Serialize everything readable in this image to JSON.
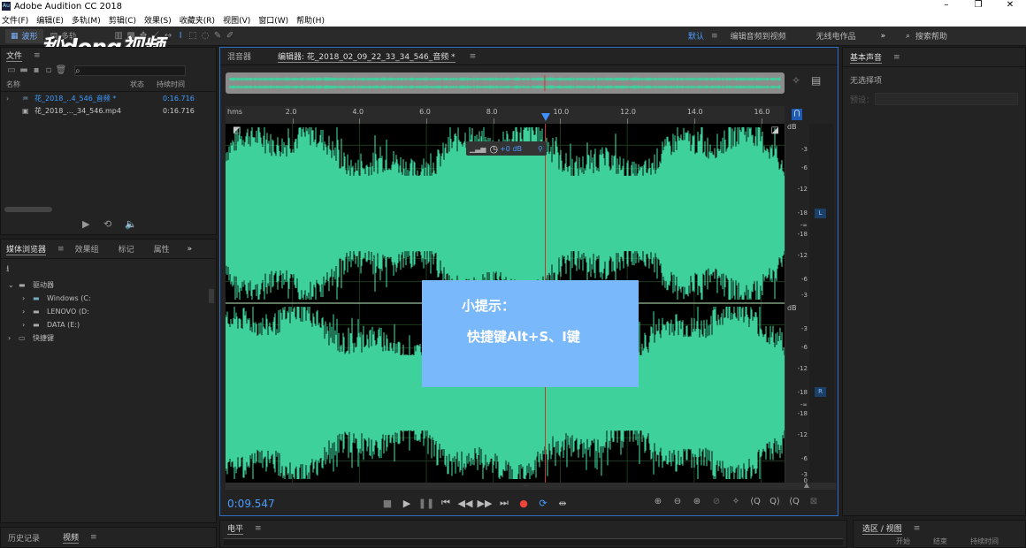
{
  "window": {
    "title": "Adobe Audition CC 2018",
    "app_badge": "Au",
    "controls": [
      "–",
      "❐",
      "✕"
    ]
  },
  "menu": [
    "文件(F)",
    "编辑(E)",
    "多轨(M)",
    "剪辑(C)",
    "效果(S)",
    "收藏夹(R)",
    "视图(V)",
    "窗口(W)",
    "帮助(H)"
  ],
  "toolbar": {
    "waveform_label": "波形",
    "multitrack_label": "多轨",
    "workspaces": [
      "默认",
      "编辑音频到视频",
      "无线电作品"
    ],
    "search_placeholder": "搜索帮助"
  },
  "watermark": "秒dong视频",
  "files_panel": {
    "tab": "文件",
    "columns": [
      "名称",
      "状态",
      "持续时间"
    ],
    "files": [
      {
        "name": "花_2018_..4_546_音频 *",
        "duration": "0:16.716",
        "selected": true
      },
      {
        "name": "花_2018_..._34_546.mp4",
        "duration": "0:16.716",
        "selected": false
      }
    ]
  },
  "media_panel": {
    "tabs": [
      "媒体浏览器",
      "效果组",
      "标记",
      "属性"
    ],
    "tree": [
      {
        "label": "驱动器",
        "level": 0
      },
      {
        "label": "Windows (C:",
        "level": 1
      },
      {
        "label": "LENOVO (D:",
        "level": 1
      },
      {
        "label": "DATA (E:)",
        "level": 1
      },
      {
        "label": "快捷键",
        "level": 0
      }
    ]
  },
  "bottom_left_tabs": [
    "历史记录",
    "视频"
  ],
  "editor": {
    "tabs": [
      "混音器",
      "编辑器: 花_2018_02_09_22_33_34_546_音频 *"
    ],
    "ruler_unit": "hms",
    "ruler_ticks": [
      "2.0",
      "4.0",
      "6.0",
      "8.0",
      "10.0",
      "12.0",
      "14.0",
      "16.0"
    ],
    "hud_gain": "+0 dB",
    "db_scale_unit": "dB",
    "db_ticks_top": [
      "-3",
      "-6",
      "-12",
      "-18",
      "-∞",
      "-18",
      "-12",
      "-6",
      "-3"
    ],
    "db_ticks_bottom": [
      "-3",
      "-6",
      "-12",
      "-18",
      "-∞",
      "-18",
      "-12",
      "-6",
      "-3",
      "0"
    ],
    "channel_left": "L",
    "channel_right": "R",
    "timecode": "0:09.547",
    "playhead_fraction": 0.572,
    "waveform_color": "#3fd19b"
  },
  "tip": {
    "title": "小提示：",
    "text": "快捷键Alt+S、I键",
    "bg": "#79b8fb"
  },
  "right_panel": {
    "title": "基本声音",
    "subtitle": "无选择项",
    "preset_label": "预设："
  },
  "bottom": {
    "level_tab": "电平",
    "selection_tab": "选区 / 视图",
    "columns": [
      "开始",
      "结束",
      "持续时间"
    ]
  }
}
